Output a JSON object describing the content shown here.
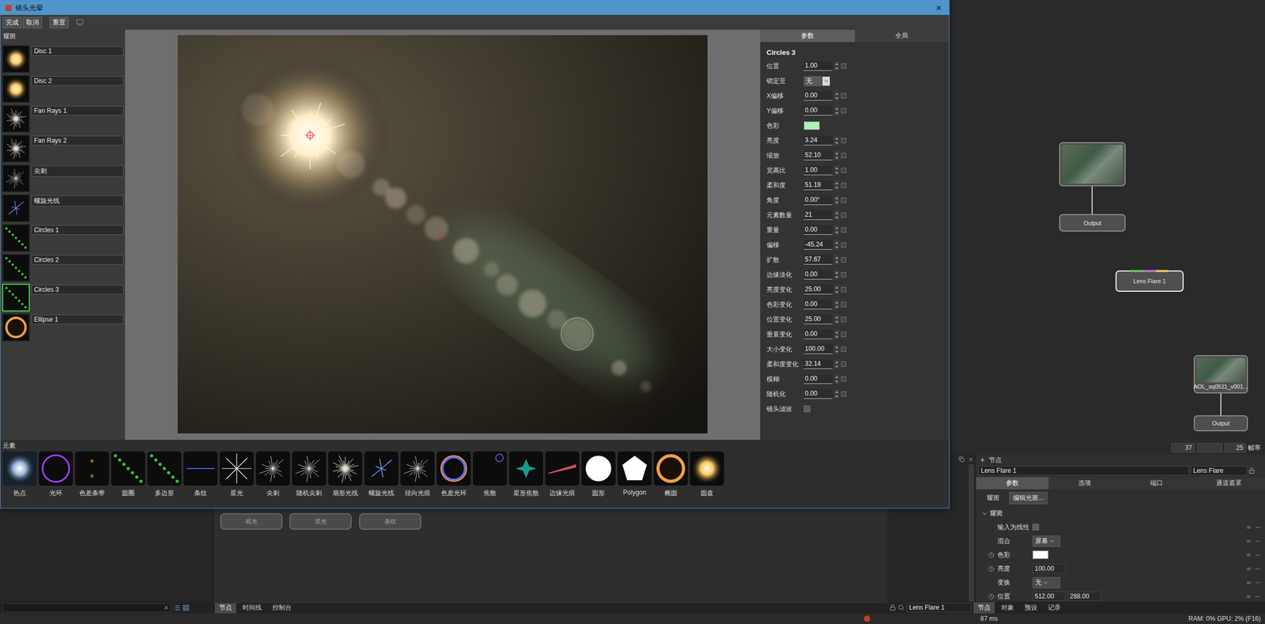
{
  "dialog": {
    "title": "镜头光晕",
    "close": "×",
    "toolbar": [
      {
        "label": "完成"
      },
      {
        "label": "取消"
      },
      {
        "label": "重置"
      }
    ],
    "flare_panel": {
      "title": "耀斑",
      "items": [
        {
          "name": "Disc 1",
          "kind": "glow",
          "selected": false
        },
        {
          "name": "Disc 2",
          "kind": "glow",
          "selected": false
        },
        {
          "name": "Fan Rays 1",
          "kind": "fan",
          "selected": false
        },
        {
          "name": "Fan Rays 2",
          "kind": "fan",
          "selected": false
        },
        {
          "name": "尖刺",
          "kind": "spike",
          "selected": false
        },
        {
          "name": "螺旋光线",
          "kind": "spiral",
          "selected": false
        },
        {
          "name": "Circles 1",
          "kind": "dots",
          "selected": false
        },
        {
          "name": "Circles 2",
          "kind": "dots",
          "selected": false
        },
        {
          "name": "Circles 3",
          "kind": "dots",
          "selected": true
        },
        {
          "name": "Ellipse 1",
          "kind": "ellipse",
          "selected": false
        }
      ]
    },
    "params": {
      "tabs": [
        {
          "label": "参数",
          "selected": true
        },
        {
          "label": "全局",
          "selected": false
        }
      ],
      "element": "Circles 3",
      "rows": [
        {
          "label": "位置",
          "kind": "number",
          "value": "1.00"
        },
        {
          "label": "锁定至",
          "kind": "select",
          "value": "无"
        },
        {
          "label": "X偏移",
          "kind": "number",
          "value": "0.00"
        },
        {
          "label": "Y偏移",
          "kind": "number",
          "value": "0.00"
        },
        {
          "label": "色彩",
          "kind": "color",
          "color": "#aef0b8"
        },
        {
          "label": "亮度",
          "kind": "number",
          "value": "3.24"
        },
        {
          "label": "缩放",
          "kind": "number",
          "value": "52.10"
        },
        {
          "label": "宽高比",
          "kind": "number",
          "value": "1.00"
        },
        {
          "label": "柔和度",
          "kind": "number",
          "value": "51.19"
        },
        {
          "label": "角度",
          "kind": "number",
          "value": "0.00°"
        },
        {
          "label": "元素数量",
          "kind": "number",
          "value": "21"
        },
        {
          "label": "重量",
          "kind": "number",
          "value": "0.00"
        },
        {
          "label": "偏移",
          "kind": "number",
          "value": "-45.24"
        },
        {
          "label": "扩散",
          "kind": "number",
          "value": "57.67"
        },
        {
          "label": "边缘淡化",
          "kind": "number",
          "value": "0.00"
        },
        {
          "label": "亮度变化",
          "kind": "number",
          "value": "25.00"
        },
        {
          "label": "色彩变化",
          "kind": "number",
          "value": "0.00"
        },
        {
          "label": "位置变化",
          "kind": "number",
          "value": "25.00"
        },
        {
          "label": "垂直变化",
          "kind": "number",
          "value": "0.00"
        },
        {
          "label": "大小变化",
          "kind": "number",
          "value": "100.00"
        },
        {
          "label": "柔和度变化",
          "kind": "number",
          "value": "32.14"
        },
        {
          "label": "模糊",
          "kind": "number",
          "value": "0.00"
        },
        {
          "label": "随机化",
          "kind": "number",
          "value": "0.00"
        },
        {
          "label": "镜头滤波",
          "kind": "checkbox",
          "checked": false
        }
      ]
    },
    "elements": {
      "title": "元素",
      "items": [
        {
          "label": "热点",
          "kind": "hotspot"
        },
        {
          "label": "光环",
          "kind": "ring"
        },
        {
          "label": "色差条带",
          "kind": "band"
        },
        {
          "label": "圆圈",
          "kind": "dots"
        },
        {
          "label": "多边形",
          "kind": "dots"
        },
        {
          "label": "条纹",
          "kind": "streak"
        },
        {
          "label": "星光",
          "kind": "star"
        },
        {
          "label": "尖刺",
          "kind": "spike"
        },
        {
          "label": "随机尖刺",
          "kind": "spike"
        },
        {
          "label": "扇形光线",
          "kind": "fan"
        },
        {
          "label": "螺旋光线",
          "kind": "spiral"
        },
        {
          "label": "径向光痕",
          "kind": "spike"
        },
        {
          "label": "色差光环",
          "kind": "rainbow"
        },
        {
          "label": "焦散",
          "kind": "caustic"
        },
        {
          "label": "星形焦散",
          "kind": "starcaustic"
        },
        {
          "label": "边缘光痕",
          "kind": "edge"
        },
        {
          "label": "圆形",
          "kind": "disc"
        },
        {
          "label": "Polygon",
          "kind": "polygon"
        },
        {
          "label": "椭圆",
          "kind": "ellipse"
        },
        {
          "label": "圆盘",
          "kind": "glow"
        }
      ]
    }
  },
  "graph": {
    "nodes": [
      {
        "kind": "thumbnail",
        "label": "",
        "selected": false
      },
      {
        "kind": "output",
        "label": "Output",
        "selected": false
      },
      {
        "kind": "effect",
        "label": "Lens Flare 1",
        "selected": true
      },
      {
        "kind": "thumbnail",
        "label": "AOL_sq0511_v001...",
        "selected": false
      },
      {
        "kind": "output",
        "label": "Output",
        "selected": false
      }
    ],
    "timeline": {
      "frame": "37",
      "fps": "25",
      "fps_label": "帧率"
    }
  },
  "node_editor": {
    "nodes": [
      {
        "label": "眩光"
      },
      {
        "label": "星光"
      },
      {
        "label": "条纹"
      }
    ]
  },
  "properties": {
    "header": "节点",
    "name": "Lens Flare 1",
    "type": "Lens Flare",
    "tabs": [
      {
        "label": "参数",
        "selected": true
      },
      {
        "label": "选项",
        "selected": false
      },
      {
        "label": "端口",
        "selected": false
      },
      {
        "label": "通道遮罩",
        "selected": false
      }
    ],
    "flare_label": "耀斑",
    "edit_button": "编辑光斑...",
    "group": {
      "title": "耀斑",
      "expanded": true
    },
    "rows": [
      {
        "label": "输入为线性",
        "kind": "checkbox",
        "checked": false,
        "animatable": false
      },
      {
        "label": "混合",
        "kind": "select",
        "value": "屏幕",
        "animatable": false
      },
      {
        "label": "色彩",
        "kind": "color",
        "color": "#ffffff",
        "animatable": true
      },
      {
        "label": "亮度",
        "kind": "number",
        "value": "100.00",
        "animatable": true
      },
      {
        "label": "变换",
        "kind": "select",
        "value": "无",
        "animatable": false
      },
      {
        "label": "位置",
        "kind": "pair",
        "values": [
          "512.00",
          "288.00"
        ],
        "animatable": true
      }
    ]
  },
  "bottom_bar": {
    "left_tabs": [
      {
        "label": "节点",
        "selected": true
      },
      {
        "label": "时间线",
        "selected": false
      },
      {
        "label": "控制台",
        "selected": false
      }
    ],
    "search_value": "Lens Flare 1",
    "right_tabs": [
      {
        "label": "节点",
        "selected": true
      },
      {
        "label": "对象",
        "selected": false
      },
      {
        "label": "预设",
        "selected": false
      },
      {
        "label": "记录",
        "selected": false
      }
    ]
  },
  "status_bar": {
    "render_time": "87 ms",
    "memory": "RAM: 0% GPU: 2% (F16)"
  }
}
